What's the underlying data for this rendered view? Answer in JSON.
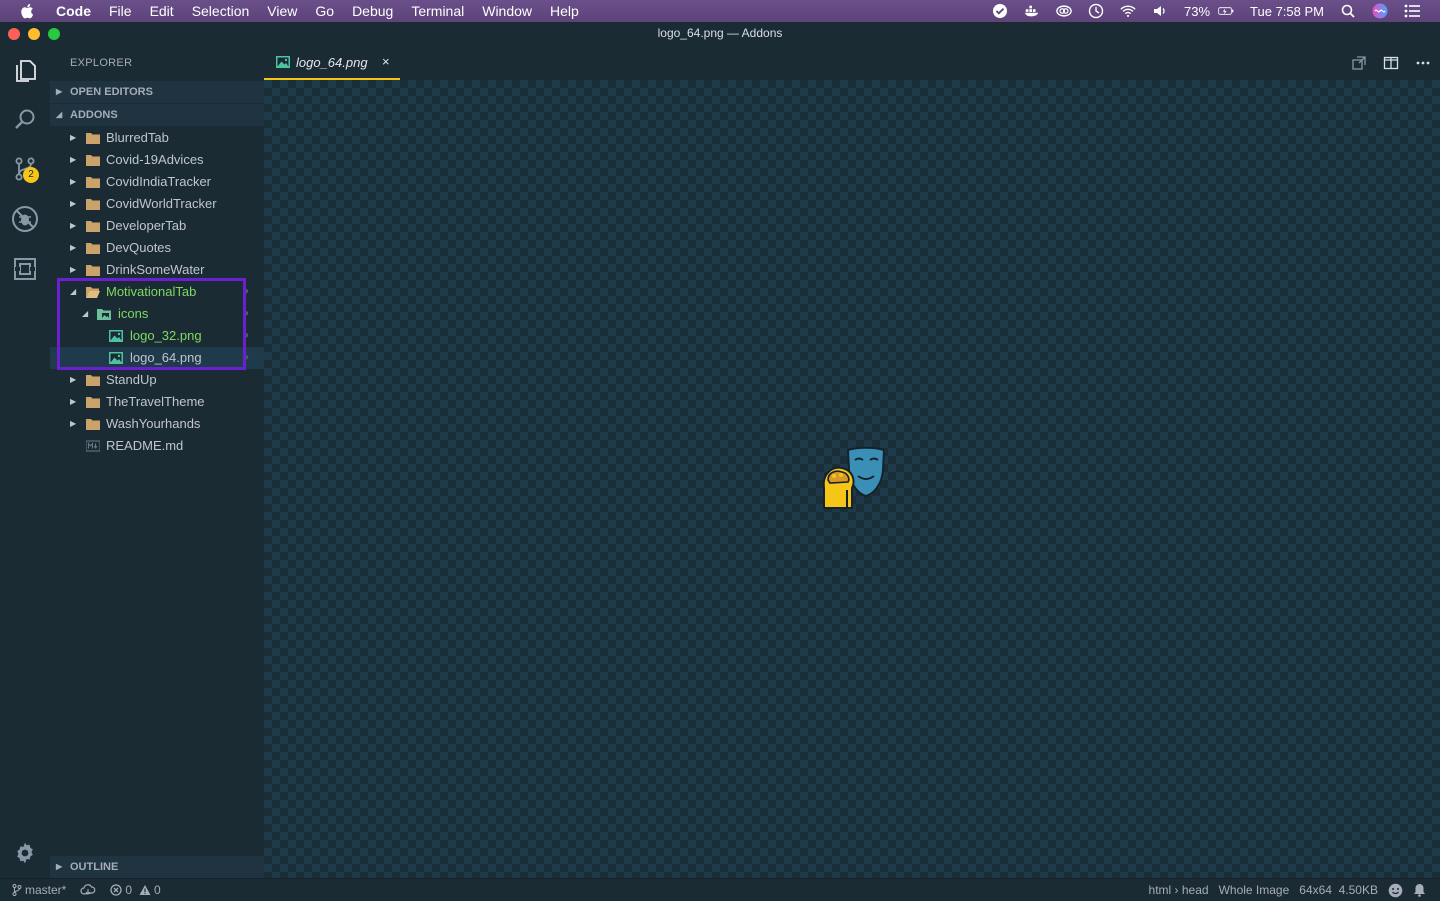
{
  "menubar": {
    "app": "Code",
    "items": [
      "File",
      "Edit",
      "Selection",
      "View",
      "Go",
      "Debug",
      "Terminal",
      "Window",
      "Help"
    ],
    "battery": "73%",
    "clock": "Tue 7:58 PM"
  },
  "window": {
    "title": "logo_64.png — Addons"
  },
  "activity": {
    "scm_badge": "2"
  },
  "sidebar": {
    "title": "EXPLORER",
    "open_editors": "OPEN EDITORS",
    "root": "ADDONS",
    "items": [
      {
        "label": "BlurredTab"
      },
      {
        "label": "Covid-19Advices"
      },
      {
        "label": "CovidIndiaTracker"
      },
      {
        "label": "CovidWorldTracker"
      },
      {
        "label": "DeveloperTab"
      },
      {
        "label": "DevQuotes"
      },
      {
        "label": "DrinkSomeWater"
      },
      {
        "label": "MotivationalTab"
      },
      {
        "label": "icons"
      },
      {
        "label": "logo_32.png"
      },
      {
        "label": "logo_64.png"
      },
      {
        "label": "StandUp"
      },
      {
        "label": "TheTravelTheme"
      },
      {
        "label": "WashYourhands"
      },
      {
        "label": "README.md"
      }
    ],
    "outline": "OUTLINE"
  },
  "editor": {
    "tab_label": "logo_64.png",
    "tab_close": "×"
  },
  "statusbar": {
    "branch": "master*",
    "errors": "0",
    "warnings": "0",
    "breadcrumb": "html › head",
    "zoom": "Whole Image",
    "image_info": "64x64  4.50KB"
  },
  "colors": {
    "accent": "#f5c518",
    "highlight": "#6a1fd0",
    "folder": "#c9a36a",
    "git_added": "#7fd962"
  }
}
